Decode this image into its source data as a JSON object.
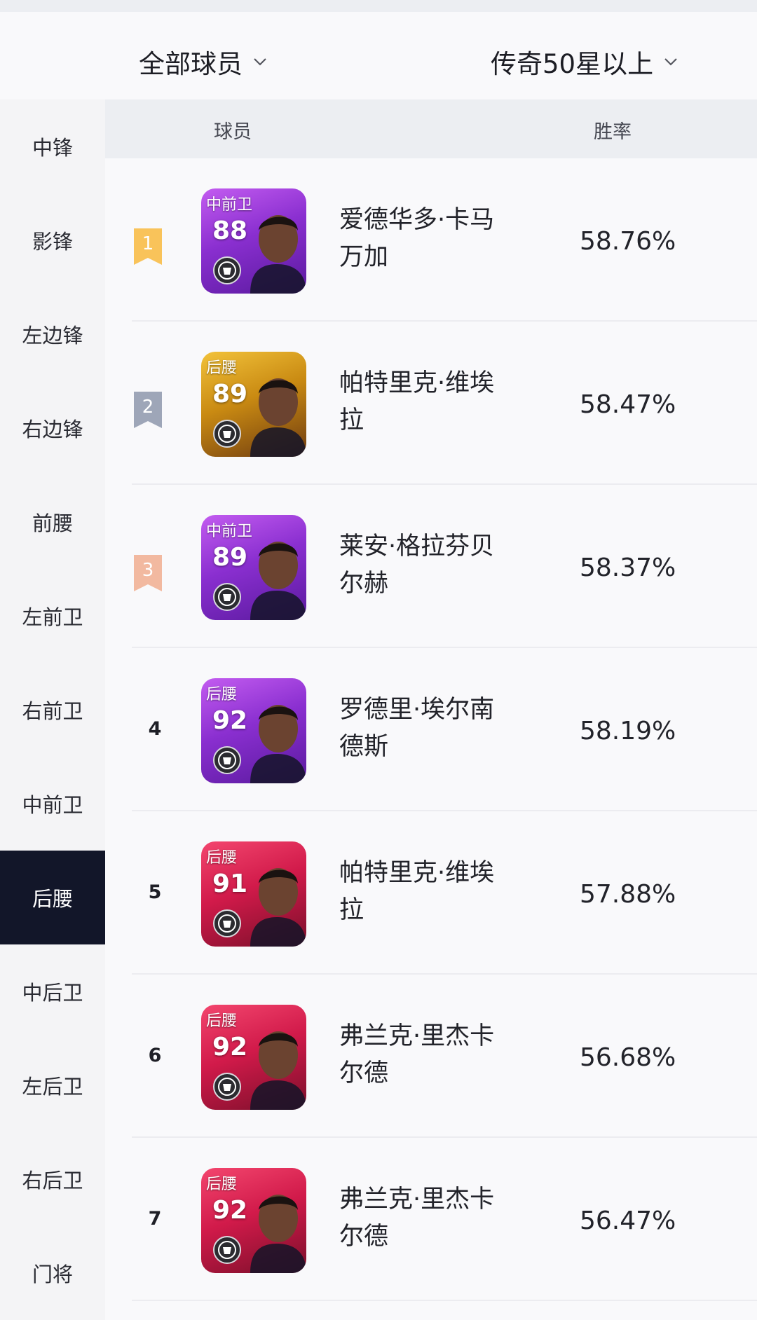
{
  "filters": {
    "players_label": "全部球员",
    "tier_label": "传奇50星以上"
  },
  "sidebar": {
    "items": [
      {
        "label": "中锋"
      },
      {
        "label": "影锋"
      },
      {
        "label": "左边锋"
      },
      {
        "label": "右边锋"
      },
      {
        "label": "前腰"
      },
      {
        "label": "左前卫"
      },
      {
        "label": "右前卫"
      },
      {
        "label": "中前卫"
      },
      {
        "label": "后腰",
        "active": true
      },
      {
        "label": "中后卫"
      },
      {
        "label": "左后卫"
      },
      {
        "label": "右后卫"
      },
      {
        "label": "门将"
      }
    ]
  },
  "table": {
    "col_player": "球员",
    "col_win_rate": "胜率",
    "rows": [
      {
        "rank": "1",
        "position": "中前卫",
        "rating": "88",
        "name_line1": "爱德华多·卡马",
        "name_line2": "万加",
        "win_rate": "58.76%",
        "card_color": "purple",
        "rank_color": "#f9c35a"
      },
      {
        "rank": "2",
        "position": "后腰",
        "rating": "89",
        "name_line1": "帕特里克·维埃",
        "name_line2": "拉",
        "win_rate": "58.47%",
        "card_color": "gold",
        "rank_color": "#9ea6b8"
      },
      {
        "rank": "3",
        "position": "中前卫",
        "rating": "89",
        "name_line1": "莱安·格拉芬贝",
        "name_line2": "尔赫",
        "win_rate": "58.37%",
        "card_color": "purple",
        "rank_color": "#f2b9a0"
      },
      {
        "rank": "4",
        "position": "后腰",
        "rating": "92",
        "name_line1": "罗德里·埃尔南",
        "name_line2": "德斯",
        "win_rate": "58.19%",
        "card_color": "purple"
      },
      {
        "rank": "5",
        "position": "后腰",
        "rating": "91",
        "name_line1": "帕特里克·维埃",
        "name_line2": "拉",
        "win_rate": "57.88%",
        "card_color": "red"
      },
      {
        "rank": "6",
        "position": "后腰",
        "rating": "92",
        "name_line1": "弗兰克·里杰卡",
        "name_line2": "尔德",
        "win_rate": "56.68%",
        "card_color": "red"
      },
      {
        "rank": "7",
        "position": "后腰",
        "rating": "92",
        "name_line1": "弗兰克·里杰卡",
        "name_line2": "尔德",
        "win_rate": "56.47%",
        "card_color": "red"
      }
    ]
  }
}
